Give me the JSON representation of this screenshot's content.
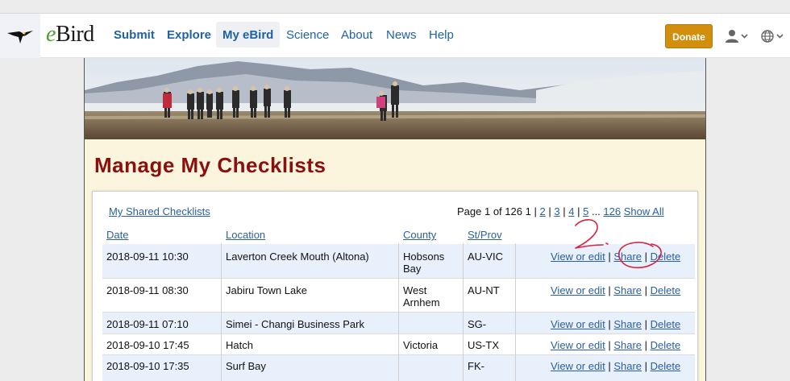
{
  "brand": {
    "logo_prefix": "e",
    "logo_suffix": "Bird"
  },
  "nav": {
    "items": [
      {
        "label": "Submit"
      },
      {
        "label": "Explore"
      },
      {
        "label": "My eBird"
      },
      {
        "label": "Science"
      },
      {
        "label": "About"
      },
      {
        "label": "News"
      },
      {
        "label": "Help"
      }
    ],
    "donate": "Donate",
    "user_icon": "user-icon",
    "language_icon": "globe-icon"
  },
  "page": {
    "title": "Manage My Checklists",
    "shared_link": "My Shared Checklists",
    "pagination": {
      "prefix": "Page 1 of 126",
      "current": "1",
      "sep": "|",
      "pages": [
        "2",
        "3",
        "4",
        "5"
      ],
      "ellipsis": "...",
      "last": "126",
      "show_all": "Show All"
    },
    "columns": {
      "date": "Date",
      "location": "Location",
      "county": "County",
      "state": "St/Prov"
    },
    "actions": {
      "view": "View or edit",
      "share": "Share",
      "delete": "Delete",
      "sep": "|"
    },
    "rows": [
      {
        "date": "2018-09-11 10:30",
        "location": "Laverton Creek Mouth (Altona)",
        "county_1": "Hobsons",
        "county_2": "Bay",
        "state": "AU-VIC"
      },
      {
        "date": "2018-09-11 08:30",
        "location": "Jabiru Town Lake",
        "county_1": "West",
        "county_2": "Arnhem",
        "state": "AU-NT"
      },
      {
        "date": "2018-09-11 07:10",
        "location": "Simei - Changi Business Park",
        "county_1": "",
        "county_2": "",
        "state": "SG-"
      },
      {
        "date": "2018-09-10 17:45",
        "location": "Hatch",
        "county_1": "Victoria",
        "county_2": "",
        "state": "US-TX"
      },
      {
        "date": "2018-09-10 17:35",
        "location": "Surf Bay",
        "county_1": "",
        "county_2": "",
        "state": "FK-"
      }
    ]
  },
  "annotation": {
    "step_label": "2.",
    "color": "#d8213d"
  },
  "colors": {
    "title": "#8a0f0f",
    "link": "#2a5fa0",
    "donate": "#d28f0e",
    "row_alt": "#e8f0fb",
    "paper": "#fcf5dd"
  }
}
